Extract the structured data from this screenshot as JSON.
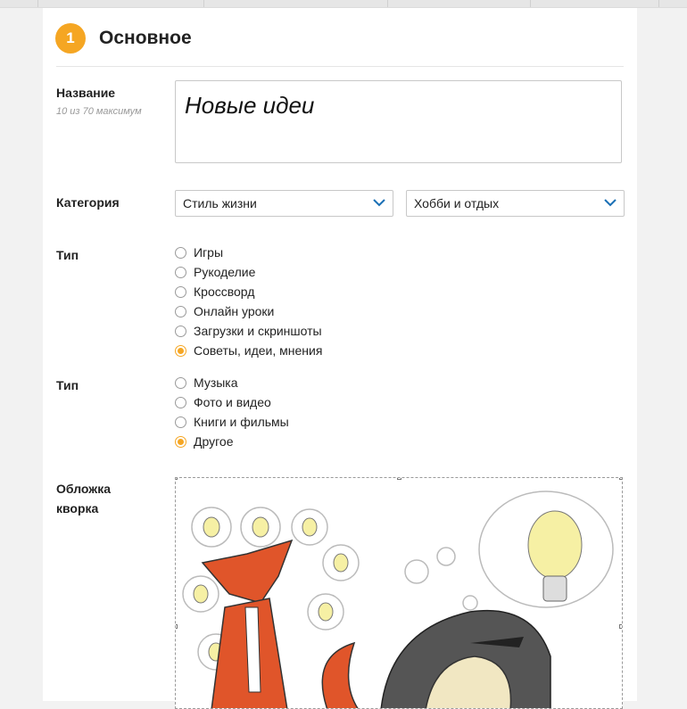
{
  "section": {
    "step": "1",
    "title": "Основное"
  },
  "name_field": {
    "label": "Название",
    "hint": "10 из 70 максимум",
    "value": "Новые идеи"
  },
  "category": {
    "label": "Категория",
    "primary": "Стиль жизни",
    "secondary": "Хобби и отдых"
  },
  "type1": {
    "label": "Тип",
    "options": [
      {
        "label": "Игры",
        "checked": false
      },
      {
        "label": "Рукоделие",
        "checked": false
      },
      {
        "label": "Кроссворд",
        "checked": false
      },
      {
        "label": "Онлайн уроки",
        "checked": false
      },
      {
        "label": "Загрузки и скриншоты",
        "checked": false
      },
      {
        "label": "Советы, идеи, мнения",
        "checked": true
      }
    ]
  },
  "type2": {
    "label": "Тип",
    "options": [
      {
        "label": "Музыка",
        "checked": false
      },
      {
        "label": "Фото и видео",
        "checked": false
      },
      {
        "label": "Книги и фильмы",
        "checked": false
      },
      {
        "label": "Другое",
        "checked": true
      }
    ]
  },
  "cover": {
    "label_line1": "Обложка",
    "label_line2": "кворка"
  },
  "colors": {
    "accent": "#f5a623",
    "chevron": "#1a6fb5",
    "fox": "#e0552a"
  }
}
